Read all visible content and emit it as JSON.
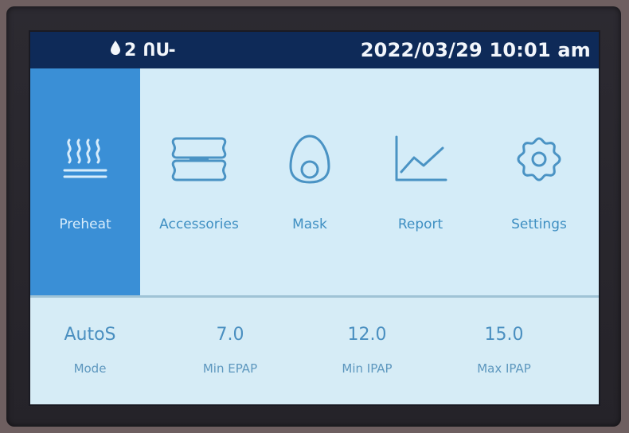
{
  "status": {
    "water_level": "2",
    "signal_symbol": "ՈՍ-",
    "datetime": "2022/03/29 10:01 am"
  },
  "menu": [
    {
      "label": "Preheat",
      "icon": "preheat-icon",
      "active": true
    },
    {
      "label": "Accessories",
      "icon": "accessories-icon",
      "active": false
    },
    {
      "label": "Mask",
      "icon": "mask-icon",
      "active": false
    },
    {
      "label": "Report",
      "icon": "report-icon",
      "active": false
    },
    {
      "label": "Settings",
      "icon": "settings-icon",
      "active": false
    }
  ],
  "params": [
    {
      "value": "AutoS",
      "name": "Mode"
    },
    {
      "value": "7.0",
      "name": "Min EPAP"
    },
    {
      "value": "12.0",
      "name": "Min IPAP"
    },
    {
      "value": "15.0",
      "name": "Max IPAP"
    }
  ],
  "colors": {
    "statusbar": "#0e2a58",
    "active_tile": "#3a8fd6",
    "screen_bg": "#d4ecf8",
    "label_text": "#3f8fc2"
  }
}
